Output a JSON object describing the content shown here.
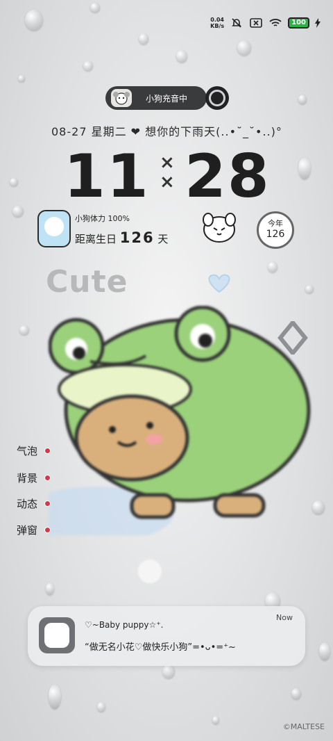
{
  "status_bar": {
    "net_speed_value": "0.04",
    "net_speed_unit": "KB/s",
    "battery": "100",
    "icons": [
      "mute-icon",
      "no-sim-icon",
      "wifi-icon",
      "battery-icon",
      "charging-icon"
    ]
  },
  "music_pill": {
    "label": "小狗充音中"
  },
  "date_line": {
    "text": "08-27 星期二 ❤ 想你的下雨天(..•˘_˘•..)°"
  },
  "clock": {
    "hours": "11",
    "minutes": "28",
    "separator": "××"
  },
  "widget": {
    "stamina": "小狗体力 100%",
    "birthday_prefix": "距离生日",
    "birthday_days": "126",
    "birthday_unit": "天",
    "year_label": "今年",
    "year_value": "126"
  },
  "decor_text": "Cute",
  "side_menu": [
    {
      "label": "气泡"
    },
    {
      "label": "背景"
    },
    {
      "label": "动态"
    },
    {
      "label": "弹窗"
    }
  ],
  "notification": {
    "title": "♡~Baby puppy☆⁺.",
    "message": "“做无名小花♡做快乐小狗”=•ᴗ•=⁺~",
    "time": "Now"
  },
  "watermark": "©MALTESE",
  "colors": {
    "pill_bg": "#3a3b3d",
    "frog_green": "#9ad17a",
    "accent_red": "#d23a4a",
    "battery_green": "#2bb34a"
  }
}
